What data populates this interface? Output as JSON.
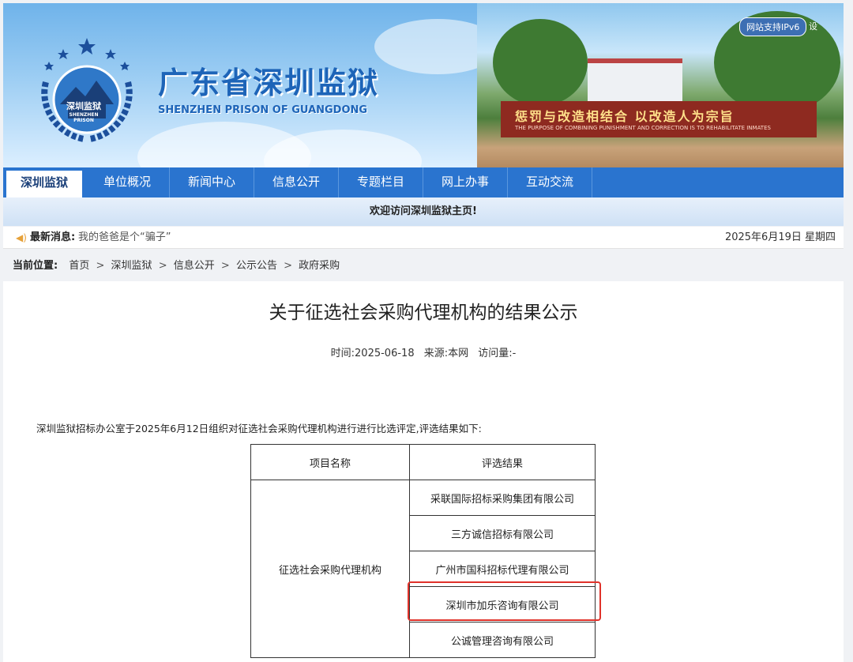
{
  "banner": {
    "title": "广东省深圳监狱",
    "subtitle": "SHENZHEN PRISON OF GUANGDONG",
    "emblem_text": "深圳监狱",
    "emblem_en": "SHENZHEN PRISON",
    "ipv6_badge": "网站支持IPv6",
    "ipv6_extra": "设",
    "slogan": "惩罚与改造相结合 以改造人为宗旨",
    "slogan_en": "THE PURPOSE OF COMBINING PUNISHMENT AND CORRECTION IS TO REHABILITATE INMATES"
  },
  "nav": {
    "items": [
      "深圳监狱",
      "单位概况",
      "新闻中心",
      "信息公开",
      "专题栏目",
      "网上办事",
      "互动交流"
    ]
  },
  "welcome": "欢迎访问深圳监狱主页!",
  "news": {
    "label": "最新消息:",
    "text": "我的爸爸是个“骗子”",
    "date": "2025年6月19日 星期四"
  },
  "breadcrumb": {
    "label": "当前位置:",
    "items": [
      "首页",
      "深圳监狱",
      "信息公开",
      "公示公告",
      "政府采购"
    ],
    "sep": ">"
  },
  "article": {
    "title": "关于征选社会采购代理机构的结果公示",
    "meta_time": "时间:2025-06-18",
    "meta_source": "来源:本网",
    "meta_views": "访问量:-",
    "intro": "深圳监狱招标办公室于2025年6月12日组织对征选社会采购代理机构进行进行比选评定,评选结果如下:",
    "table": {
      "headers": [
        "项目名称",
        "评选结果"
      ],
      "project": "征选社会采购代理机构",
      "results": [
        "采联国际招标采购集团有限公司",
        "三方诚信招标有限公司",
        "广州市国科招标代理有限公司",
        "深圳市加乐咨询有限公司",
        "公诚管理咨询有限公司"
      ]
    }
  },
  "colors": {
    "nav": "#2a74cf",
    "title": "#1d64b8",
    "highlight": "#e0322a"
  }
}
